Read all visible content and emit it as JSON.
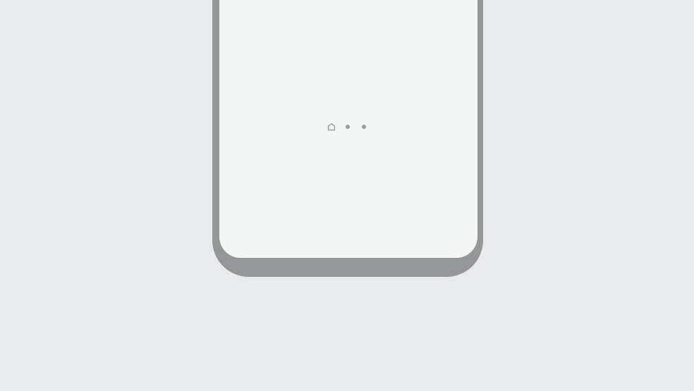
{
  "theme": {
    "background": "#e9eaec",
    "frame": "#959697",
    "screen": "#f4f6f5",
    "indicator": "#9b9c9d"
  },
  "page_indicator": {
    "items": [
      {
        "icon": "home-icon",
        "active": false
      },
      {
        "icon": "dot",
        "active": false
      },
      {
        "icon": "dot",
        "active": false
      }
    ]
  }
}
